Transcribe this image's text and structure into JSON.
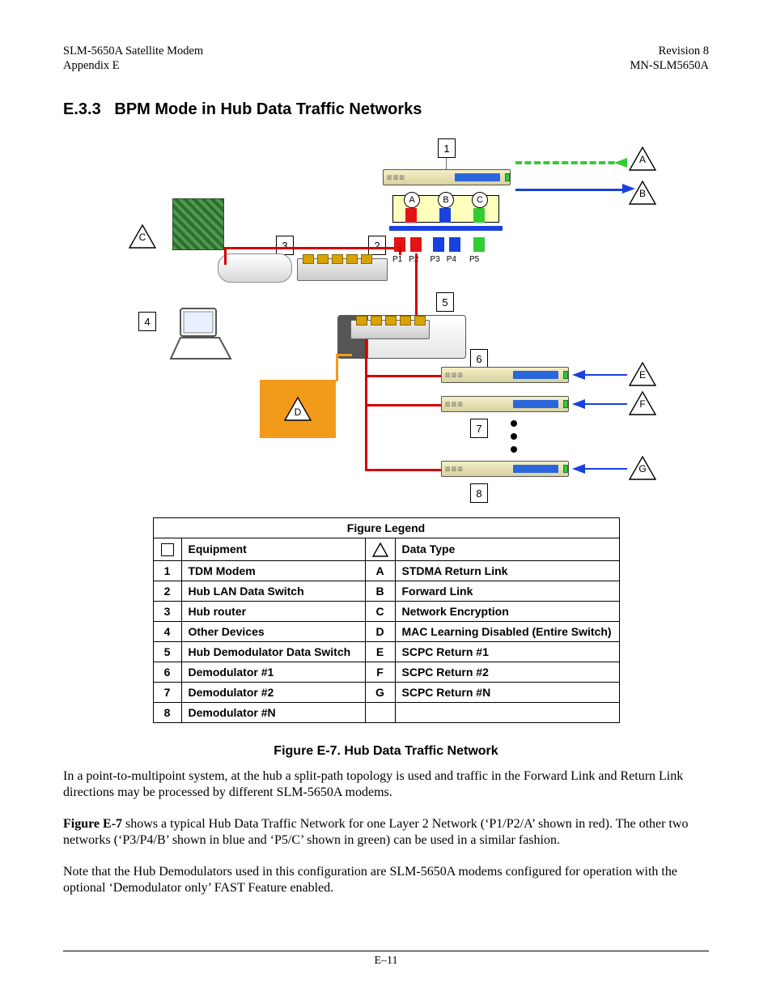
{
  "header": {
    "left_line1": "SLM-5650A Satellite Modem",
    "left_line2": "Appendix E",
    "right_line1": "Revision 8",
    "right_line2": "MN-SLM5650A"
  },
  "section": {
    "number": "E.3.3",
    "title": "BPM Mode in Hub Data Traffic Networks"
  },
  "figure": {
    "caption": "Figure E-7. Hub Data Traffic Network",
    "numbers": {
      "n1": "1",
      "n2": "2",
      "n3": "3",
      "n4": "4",
      "n5": "5",
      "n6": "6",
      "n7": "7",
      "n8": "8"
    },
    "triangles": {
      "A": "A",
      "B": "B",
      "C": "C",
      "D": "D",
      "E": "E",
      "F": "F",
      "G": "G"
    },
    "switch_circles": {
      "A": "A",
      "B": "B",
      "C": "C"
    },
    "port_labels": {
      "p1": "P1",
      "p2": "P2",
      "p3": "P3",
      "p4": "P4",
      "p5": "P5"
    }
  },
  "legend": {
    "title": "Figure Legend",
    "col_equipment": "Equipment",
    "col_datatype": "Data Type",
    "rows": [
      {
        "n": "1",
        "eq": "TDM Modem",
        "l": "A",
        "dt": "STDMA Return Link"
      },
      {
        "n": "2",
        "eq": "Hub LAN Data Switch",
        "l": "B",
        "dt": "Forward Link"
      },
      {
        "n": "3",
        "eq": "Hub router",
        "l": "C",
        "dt": "Network Encryption"
      },
      {
        "n": "4",
        "eq": "Other Devices",
        "l": "D",
        "dt": "MAC Learning Disabled (Entire Switch)"
      },
      {
        "n": "5",
        "eq": "Hub Demodulator Data Switch",
        "l": "E",
        "dt": "SCPC Return #1"
      },
      {
        "n": "6",
        "eq": "Demodulator #1",
        "l": "F",
        "dt": "SCPC Return #2"
      },
      {
        "n": "7",
        "eq": "Demodulator #2",
        "l": "G",
        "dt": "SCPC Return #N"
      },
      {
        "n": "8",
        "eq": "Demodulator #N",
        "l": "",
        "dt": ""
      }
    ]
  },
  "paragraphs": {
    "p1": "In a point-to-multipoint system, at the hub a split-path topology is used and traffic in the Forward Link and Return Link directions may be processed by different SLM-5650A modems.",
    "p2a": "Figure E-7",
    "p2b": " shows a typical Hub Data Traffic Network for one Layer 2 Network (‘P1/P2/A’ shown in red). The other two networks (‘P3/P4/B’ shown in blue and ‘P5/C’ shown in green) can be used in a similar fashion.",
    "p3": "Note that the Hub Demodulators used in this configuration are SLM-5650A modems configured for operation with the optional ‘Demodulator only’ FAST Feature enabled."
  },
  "footer": {
    "page": "E–11"
  }
}
